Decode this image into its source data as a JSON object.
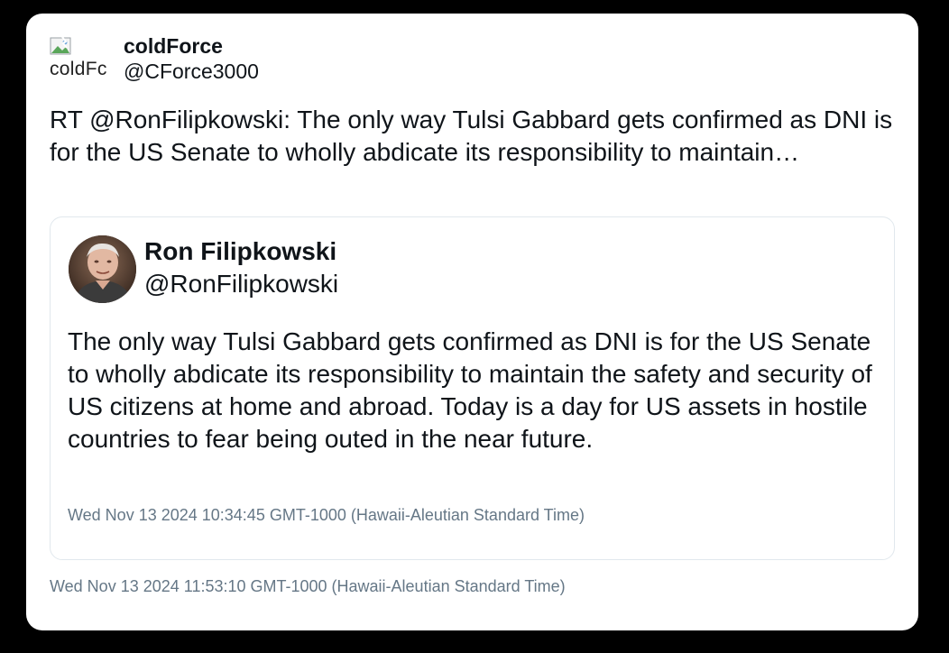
{
  "tweet": {
    "avatar_alt": "coldFc",
    "display_name": "coldForce",
    "handle": "@CForce3000",
    "text": "RT @RonFilipkowski: The only way Tulsi Gabbard gets confirmed as DNI is for the US Senate to wholly abdicate its responsibility to maintain…",
    "timestamp": "Wed Nov 13 2024 11:53:10 GMT-1000 (Hawaii-Aleutian Standard Time)"
  },
  "quoted_tweet": {
    "display_name": "Ron Filipkowski",
    "handle": "@RonFilipkowski",
    "text": "The only way Tulsi Gabbard gets confirmed as DNI is for the US Senate to wholly abdicate its responsibility to maintain the safety and security of US citizens at home and abroad. Today is a day for US assets in hostile countries to fear being outed in the near future.",
    "timestamp": "Wed Nov 13 2024 10:34:45 GMT-1000 (Hawaii-Aleutian Standard Time)"
  },
  "colors": {
    "background": "#000000",
    "card": "#ffffff",
    "text": "#0f1419",
    "muted": "#657786",
    "border": "#e1e8ed"
  },
  "icons": {
    "broken_image": "broken-image-icon",
    "avatar": "profile-photo"
  }
}
